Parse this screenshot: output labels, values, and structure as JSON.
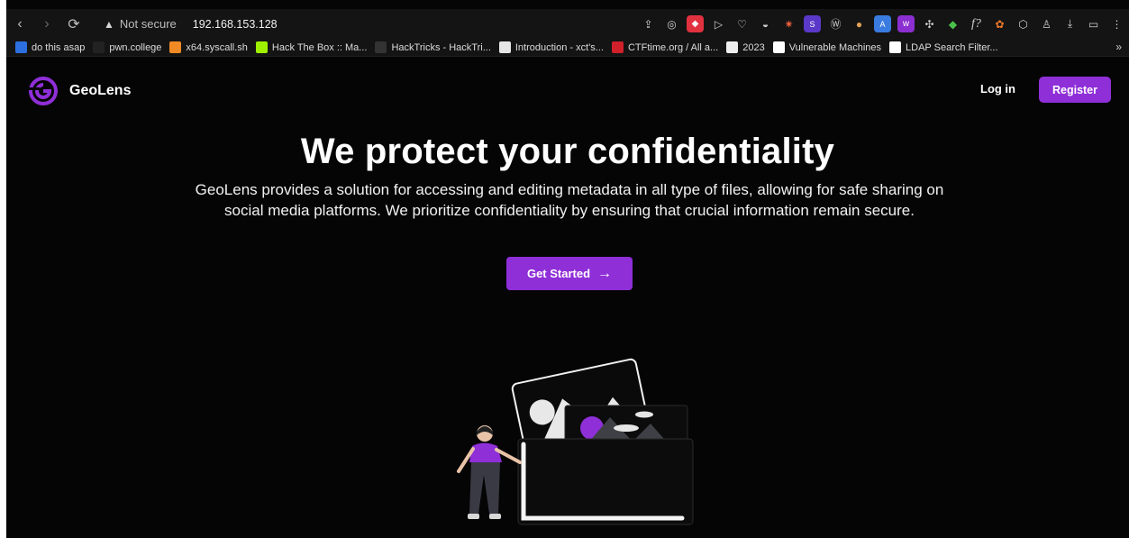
{
  "browser": {
    "nav": {
      "back_icon": "‹",
      "forward_icon": "›",
      "reload_icon": "⟳"
    },
    "security_label": "Not secure",
    "url": "192.168.153.128",
    "bookmarks": [
      {
        "label": "do this asap",
        "color": "#2d6fe0"
      },
      {
        "label": "pwn.college",
        "color": "#222222"
      },
      {
        "label": "x64.syscall.sh",
        "color": "#f08a24"
      },
      {
        "label": "Hack The Box :: Ma...",
        "color": "#9fef00"
      },
      {
        "label": "HackTricks - HackTri...",
        "color": "#333333"
      },
      {
        "label": "Introduction - xct's...",
        "color": "#e6e6e6"
      },
      {
        "label": "CTFtime.org / All a...",
        "color": "#d0202a"
      },
      {
        "label": "2023",
        "color": "#eeeeee"
      },
      {
        "label": "Vulnerable Machines",
        "color": "#ffffff"
      },
      {
        "label": "LDAP Search Filter...",
        "color": "#ffffff"
      }
    ],
    "more_bookmarks": "»"
  },
  "site": {
    "brand": "GeoLens",
    "accent_color": "#8f2fd8",
    "header": {
      "login_label": "Log in",
      "register_label": "Register"
    },
    "hero": {
      "title": "We protect your confidentiality",
      "description": "GeoLens provides a solution for accessing and editing metadata in all type of files, allowing for safe sharing on social media platforms. We prioritize confidentiality by ensuring that crucial information remain secure.",
      "cta_label": "Get Started",
      "cta_icon": "→"
    }
  }
}
